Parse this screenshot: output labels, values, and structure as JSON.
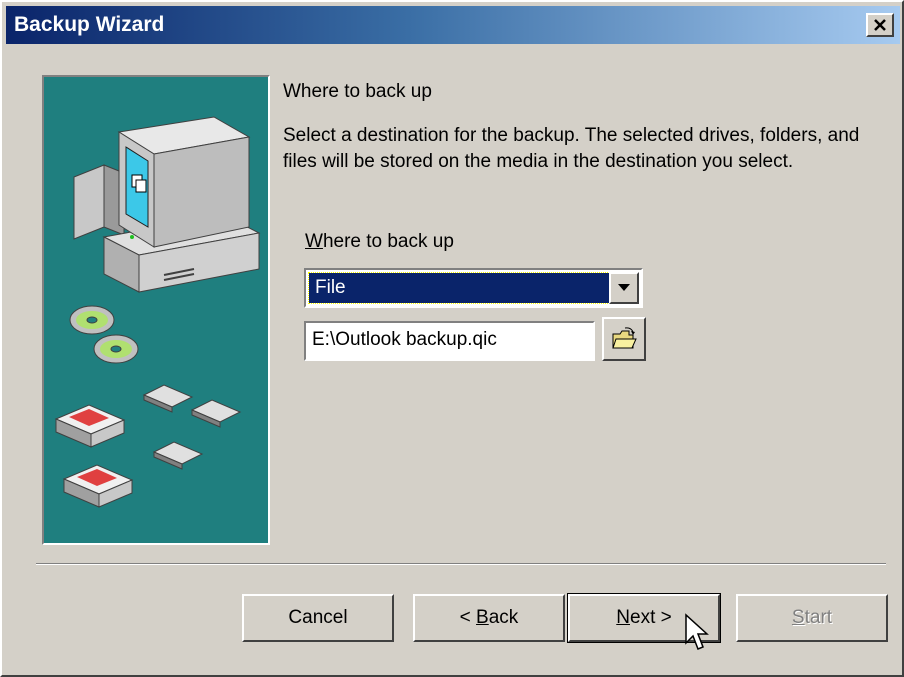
{
  "window": {
    "title": "Backup Wizard",
    "close_label": "×"
  },
  "page": {
    "heading": "Where to back up",
    "description": "Select a destination for the backup.  The selected drives, folders, and files will be stored on the media in the destination you select."
  },
  "form": {
    "where_label_mnemonic": "W",
    "where_label_rest": "here to back up",
    "destination_type": {
      "selected": "File"
    },
    "backup_path": "E:\\Outlook backup.qic"
  },
  "buttons": {
    "cancel": "Cancel",
    "back_prefix": "< ",
    "back_mnemonic": "B",
    "back_rest": "ack",
    "next_mnemonic": "N",
    "next_rest": "ext >",
    "start_mnemonic": "S",
    "start_rest": "tart"
  },
  "icons": {
    "close": "close-icon",
    "dropdown": "chevron-down-icon",
    "browse": "open-folder-icon",
    "cursor": "mouse-pointer-icon"
  },
  "colors": {
    "titlebar_start": "#0a246a",
    "titlebar_end": "#a6caf0",
    "dialog_bg": "#d4d0c8",
    "art_bg": "#1f7f7f",
    "selection": "#0a246a"
  }
}
